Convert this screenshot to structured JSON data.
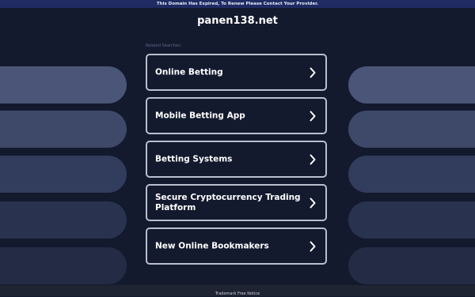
{
  "banner": {
    "text": "This Domain Has Expired, To Renew Please Contact Your Provider."
  },
  "header": {
    "domain": "panen138.net"
  },
  "related": {
    "label": "Related Searches:",
    "items": [
      {
        "label": "Online Betting",
        "icon": "chevron-right-icon"
      },
      {
        "label": "Mobile Betting App",
        "icon": "chevron-right-icon"
      },
      {
        "label": "Betting Systems",
        "icon": "chevron-right-icon"
      },
      {
        "label": "Secure Cryptocurrency Trading Platform",
        "icon": "chevron-right-icon"
      },
      {
        "label": "New Online Bookmakers",
        "icon": "chevron-right-icon"
      }
    ]
  },
  "footer": {
    "notice": "Trademark Free Notice"
  },
  "colors": {
    "background": "#131a2e",
    "banner": "#1f2b63",
    "button_border": "#b9bfce",
    "decor_shapes": [
      "#4b5578",
      "#3e4869",
      "#323c5c",
      "#29324f",
      "#232b45"
    ]
  }
}
